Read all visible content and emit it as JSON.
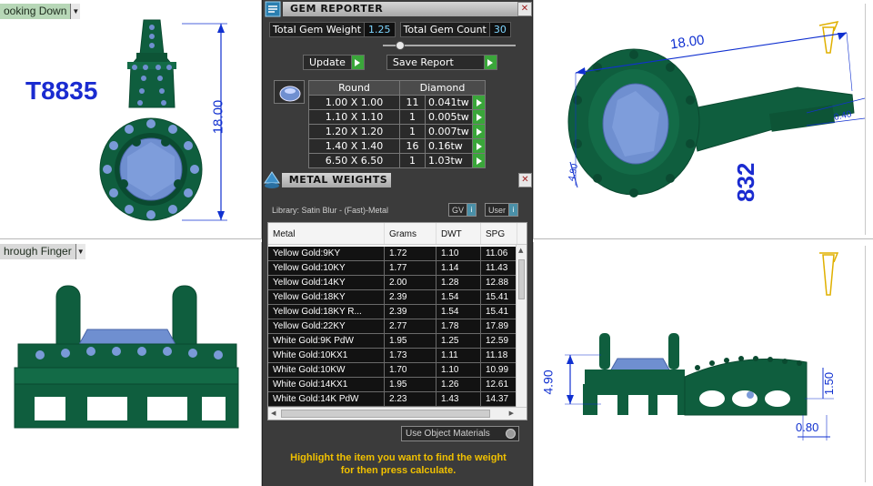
{
  "viewports": {
    "top_left": {
      "label": "ooking Down",
      "product_code": "T8835",
      "dimension": "18.00"
    },
    "top_right": {
      "dimension_main": "18.00",
      "dimension_small": "4.90",
      "dimension_side": "0.40",
      "rotated_code": "832"
    },
    "bottom_left": {
      "label": "hrough Finger"
    },
    "bottom_right": {
      "dim_height": "4.90",
      "dim_right": "1.50",
      "dim_bottom": "0.80"
    }
  },
  "gem_reporter": {
    "title": "GEM REPORTER",
    "total_weight_label": "Total Gem Weight",
    "total_weight_value": "1.25",
    "total_count_label": "Total Gem Count",
    "total_count_value": "30",
    "update_label": "Update",
    "save_report_label": "Save Report",
    "table_headers": [
      "Round",
      "Diamond"
    ],
    "gems": [
      {
        "size": "1.00 X 1.00",
        "count": "11",
        "weight": "0.041tw"
      },
      {
        "size": "1.10 X 1.10",
        "count": "1",
        "weight": "0.005tw"
      },
      {
        "size": "1.20 X 1.20",
        "count": "1",
        "weight": "0.007tw"
      },
      {
        "size": "1.40 X 1.40",
        "count": "16",
        "weight": "0.16tw"
      },
      {
        "size": "6.50 X 6.50",
        "count": "1",
        "weight": "1.03tw"
      }
    ]
  },
  "metal_weights": {
    "title": "METAL WEIGHTS",
    "library": "Library: Satin Blur - (Fast)-Metal",
    "gv_label": "GV",
    "user_label": "User",
    "columns": [
      "Metal",
      "Grams",
      "DWT",
      "SPG"
    ],
    "rows": [
      [
        "Yellow Gold:9KY",
        "1.72",
        "1.10",
        "11.06"
      ],
      [
        "Yellow Gold:10KY",
        "1.77",
        "1.14",
        "11.43"
      ],
      [
        "Yellow Gold:14KY",
        "2.00",
        "1.28",
        "12.88"
      ],
      [
        "Yellow Gold:18KY",
        "2.39",
        "1.54",
        "15.41"
      ],
      [
        "Yellow Gold:18KY R...",
        "2.39",
        "1.54",
        "15.41"
      ],
      [
        "Yellow Gold:22KY",
        "2.77",
        "1.78",
        "17.89"
      ],
      [
        "White Gold:9K PdW",
        "1.95",
        "1.25",
        "12.59"
      ],
      [
        "White Gold:10KX1",
        "1.73",
        "1.11",
        "11.18"
      ],
      [
        "White Gold:10KW",
        "1.70",
        "1.10",
        "10.99"
      ],
      [
        "White Gold:14KX1",
        "1.95",
        "1.26",
        "12.61"
      ],
      [
        "White Gold:14K PdW",
        "2.23",
        "1.43",
        "14.37"
      ]
    ],
    "use_object_materials": "Use Object Materials",
    "instructions_line1": "Highlight the item you want to find the weight",
    "instructions_line2": "for then press calculate."
  },
  "colors": {
    "metal_green": "#0f5e3e",
    "stone_blue": "#6f8fd0",
    "dimension_blue": "#1030d0",
    "panel_bg": "#3b3b3b",
    "accent_green": "#3aa63a",
    "highlight_text": "#f0c000"
  }
}
